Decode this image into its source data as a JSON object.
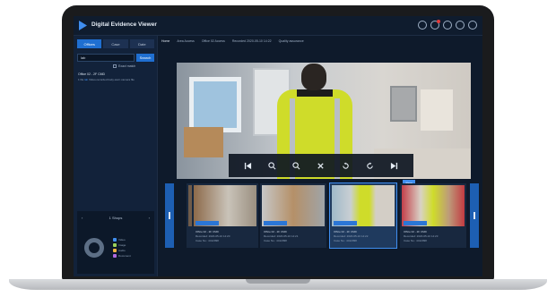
{
  "app": {
    "title": "Digital Evidence Viewer",
    "header_icons": [
      "user-icon",
      "notification-icon",
      "help-icon",
      "settings-icon",
      "power-icon"
    ],
    "accent_color": "#1f6fd1"
  },
  "sidebar": {
    "tabs": [
      {
        "label": "Offices",
        "active": true
      },
      {
        "label": "Case",
        "active": false
      },
      {
        "label": "Date",
        "active": false
      }
    ],
    "search": {
      "value": "lab",
      "button_label": "Search"
    },
    "checkbox_label": "Exact match",
    "result": {
      "title": "Office 02 - 2F CMD",
      "detail_prefix": "1 file",
      "detail_highlight": "lab",
      "detail_suffix": "Video-recorded body-worn camera file"
    },
    "stats": {
      "title": "1 Shops",
      "legend": [
        {
          "label": "Video",
          "color": "#3f8ef0"
        },
        {
          "label": "Image",
          "color": "#9bd15a"
        },
        {
          "label": "Audio",
          "color": "#f0b33f"
        },
        {
          "label": "Document",
          "color": "#b06ae0"
        }
      ]
    }
  },
  "breadcrumb": [
    "Home",
    "Area Access",
    "Office 02 Access",
    "Recorded 2020-05-10 14:22",
    "Quality assurance"
  ],
  "viewer": {
    "controls": [
      "skip-back-icon",
      "zoom-in-icon",
      "zoom-out-icon",
      "close-icon",
      "rotate-left-icon",
      "rotate-right-icon",
      "skip-forward-icon"
    ]
  },
  "filmstrip": {
    "new_badge": "New",
    "thumbs": [
      {
        "l1": "Office 02 - 2F CMD",
        "l2": "Recorded: 2020-05-10 14:20",
        "l3": "Case No.: 4412098",
        "active": false
      },
      {
        "l1": "Office 02 - 2F CMD",
        "l2": "Recorded: 2020-05-10 14:21",
        "l3": "Case No.: 4412098",
        "active": false
      },
      {
        "l1": "Office 02 - 2F CMD",
        "l2": "Recorded: 2020-05-10 14:22",
        "l3": "Case No.: 4412098",
        "active": true
      },
      {
        "l1": "Office 02 - 2F CMD",
        "l2": "Recorded: 2020-05-10 14:23",
        "l3": "Case No.: 4412098",
        "active": false
      }
    ]
  }
}
